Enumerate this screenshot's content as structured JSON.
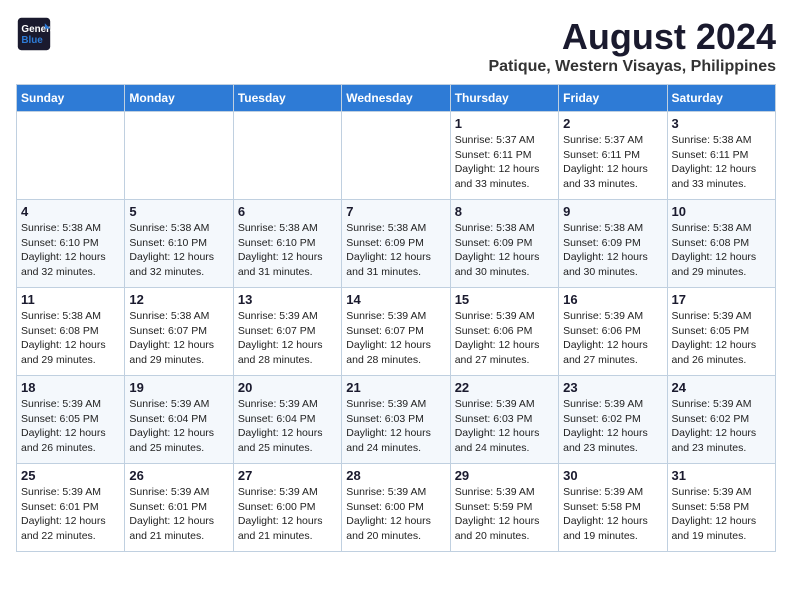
{
  "logo": {
    "line1": "General",
    "line2": "Blue"
  },
  "title": "August 2024",
  "subtitle": "Patique, Western Visayas, Philippines",
  "days_of_week": [
    "Sunday",
    "Monday",
    "Tuesday",
    "Wednesday",
    "Thursday",
    "Friday",
    "Saturday"
  ],
  "weeks": [
    [
      {
        "day": "",
        "info": ""
      },
      {
        "day": "",
        "info": ""
      },
      {
        "day": "",
        "info": ""
      },
      {
        "day": "",
        "info": ""
      },
      {
        "day": "1",
        "info": "Sunrise: 5:37 AM\nSunset: 6:11 PM\nDaylight: 12 hours\nand 33 minutes."
      },
      {
        "day": "2",
        "info": "Sunrise: 5:37 AM\nSunset: 6:11 PM\nDaylight: 12 hours\nand 33 minutes."
      },
      {
        "day": "3",
        "info": "Sunrise: 5:38 AM\nSunset: 6:11 PM\nDaylight: 12 hours\nand 33 minutes."
      }
    ],
    [
      {
        "day": "4",
        "info": "Sunrise: 5:38 AM\nSunset: 6:10 PM\nDaylight: 12 hours\nand 32 minutes."
      },
      {
        "day": "5",
        "info": "Sunrise: 5:38 AM\nSunset: 6:10 PM\nDaylight: 12 hours\nand 32 minutes."
      },
      {
        "day": "6",
        "info": "Sunrise: 5:38 AM\nSunset: 6:10 PM\nDaylight: 12 hours\nand 31 minutes."
      },
      {
        "day": "7",
        "info": "Sunrise: 5:38 AM\nSunset: 6:09 PM\nDaylight: 12 hours\nand 31 minutes."
      },
      {
        "day": "8",
        "info": "Sunrise: 5:38 AM\nSunset: 6:09 PM\nDaylight: 12 hours\nand 30 minutes."
      },
      {
        "day": "9",
        "info": "Sunrise: 5:38 AM\nSunset: 6:09 PM\nDaylight: 12 hours\nand 30 minutes."
      },
      {
        "day": "10",
        "info": "Sunrise: 5:38 AM\nSunset: 6:08 PM\nDaylight: 12 hours\nand 29 minutes."
      }
    ],
    [
      {
        "day": "11",
        "info": "Sunrise: 5:38 AM\nSunset: 6:08 PM\nDaylight: 12 hours\nand 29 minutes."
      },
      {
        "day": "12",
        "info": "Sunrise: 5:38 AM\nSunset: 6:07 PM\nDaylight: 12 hours\nand 29 minutes."
      },
      {
        "day": "13",
        "info": "Sunrise: 5:39 AM\nSunset: 6:07 PM\nDaylight: 12 hours\nand 28 minutes."
      },
      {
        "day": "14",
        "info": "Sunrise: 5:39 AM\nSunset: 6:07 PM\nDaylight: 12 hours\nand 28 minutes."
      },
      {
        "day": "15",
        "info": "Sunrise: 5:39 AM\nSunset: 6:06 PM\nDaylight: 12 hours\nand 27 minutes."
      },
      {
        "day": "16",
        "info": "Sunrise: 5:39 AM\nSunset: 6:06 PM\nDaylight: 12 hours\nand 27 minutes."
      },
      {
        "day": "17",
        "info": "Sunrise: 5:39 AM\nSunset: 6:05 PM\nDaylight: 12 hours\nand 26 minutes."
      }
    ],
    [
      {
        "day": "18",
        "info": "Sunrise: 5:39 AM\nSunset: 6:05 PM\nDaylight: 12 hours\nand 26 minutes."
      },
      {
        "day": "19",
        "info": "Sunrise: 5:39 AM\nSunset: 6:04 PM\nDaylight: 12 hours\nand 25 minutes."
      },
      {
        "day": "20",
        "info": "Sunrise: 5:39 AM\nSunset: 6:04 PM\nDaylight: 12 hours\nand 25 minutes."
      },
      {
        "day": "21",
        "info": "Sunrise: 5:39 AM\nSunset: 6:03 PM\nDaylight: 12 hours\nand 24 minutes."
      },
      {
        "day": "22",
        "info": "Sunrise: 5:39 AM\nSunset: 6:03 PM\nDaylight: 12 hours\nand 24 minutes."
      },
      {
        "day": "23",
        "info": "Sunrise: 5:39 AM\nSunset: 6:02 PM\nDaylight: 12 hours\nand 23 minutes."
      },
      {
        "day": "24",
        "info": "Sunrise: 5:39 AM\nSunset: 6:02 PM\nDaylight: 12 hours\nand 23 minutes."
      }
    ],
    [
      {
        "day": "25",
        "info": "Sunrise: 5:39 AM\nSunset: 6:01 PM\nDaylight: 12 hours\nand 22 minutes."
      },
      {
        "day": "26",
        "info": "Sunrise: 5:39 AM\nSunset: 6:01 PM\nDaylight: 12 hours\nand 21 minutes."
      },
      {
        "day": "27",
        "info": "Sunrise: 5:39 AM\nSunset: 6:00 PM\nDaylight: 12 hours\nand 21 minutes."
      },
      {
        "day": "28",
        "info": "Sunrise: 5:39 AM\nSunset: 6:00 PM\nDaylight: 12 hours\nand 20 minutes."
      },
      {
        "day": "29",
        "info": "Sunrise: 5:39 AM\nSunset: 5:59 PM\nDaylight: 12 hours\nand 20 minutes."
      },
      {
        "day": "30",
        "info": "Sunrise: 5:39 AM\nSunset: 5:58 PM\nDaylight: 12 hours\nand 19 minutes."
      },
      {
        "day": "31",
        "info": "Sunrise: 5:39 AM\nSunset: 5:58 PM\nDaylight: 12 hours\nand 19 minutes."
      }
    ]
  ]
}
